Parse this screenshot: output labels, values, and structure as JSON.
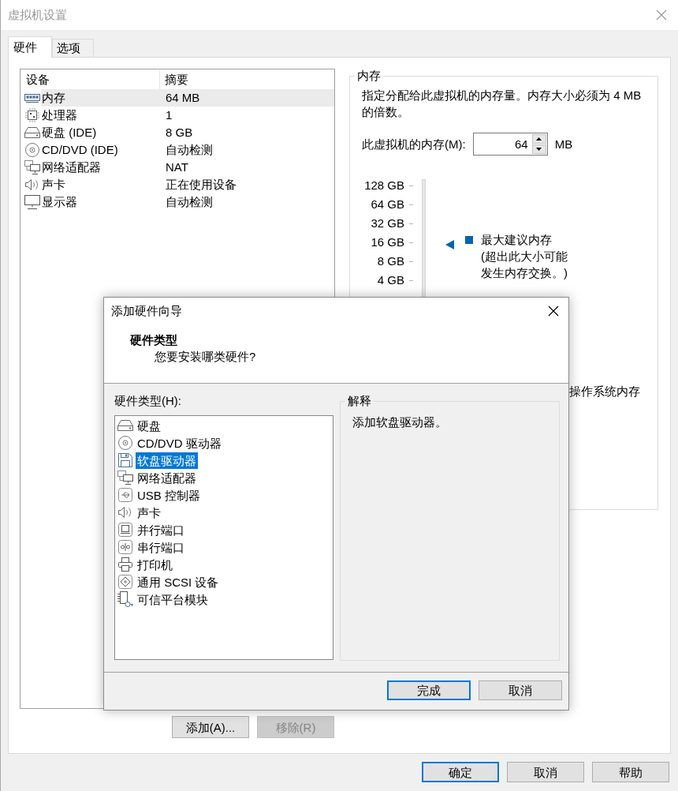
{
  "window": {
    "title": "虚拟机设置",
    "active": false
  },
  "tabs": [
    {
      "label": "硬件",
      "selected": true
    },
    {
      "label": "选项",
      "selected": false
    }
  ],
  "device_table": {
    "columns": [
      "设备",
      "摘要"
    ],
    "rows": [
      {
        "kind": "memory",
        "device": "内存",
        "summary": "64 MB",
        "selected": true
      },
      {
        "kind": "processor",
        "device": "处理器",
        "summary": "1",
        "selected": false
      },
      {
        "kind": "hard-disk",
        "device": "硬盘 (IDE)",
        "summary": "8 GB",
        "selected": false
      },
      {
        "kind": "cd-dvd",
        "device": "CD/DVD (IDE)",
        "summary": "自动检测",
        "selected": false
      },
      {
        "kind": "network",
        "device": "网络适配器",
        "summary": "NAT",
        "selected": false
      },
      {
        "kind": "sound",
        "device": "声卡",
        "summary": "正在使用设备",
        "selected": false
      },
      {
        "kind": "display",
        "device": "显示器",
        "summary": "自动检测",
        "selected": false
      }
    ]
  },
  "device_buttons": [
    {
      "label": "添加(A)...",
      "disabled": false
    },
    {
      "label": "移除(R)",
      "disabled": true
    }
  ],
  "memory_panel": {
    "title": "内存",
    "description": "指定分配给此虚拟机的内存量。内存大小必须为 4 MB 的倍数。",
    "field_label": "此虚拟机的内存(M):",
    "value": "64",
    "unit": "MB",
    "scale_labels": [
      "128 GB",
      "64 GB",
      "32 GB",
      "16 GB",
      "8 GB",
      "4 GB"
    ],
    "legend": [
      {
        "label": "最大建议内存",
        "note": "(超出此大小可能发生内存交换。)",
        "color": "#0063b1"
      }
    ],
    "partial_label": "操作系统内存"
  },
  "buttons": [
    {
      "label": "确定",
      "default": true
    },
    {
      "label": "取消",
      "default": false
    },
    {
      "label": "帮助",
      "default": false
    }
  ],
  "wizard": {
    "title": "添加硬件向导",
    "heading": "硬件类型",
    "subheading": "您要安装哪类硬件?",
    "list_label": "硬件类型(H):",
    "items": [
      {
        "kind": "hard-disk",
        "label": "硬盘",
        "selected": false
      },
      {
        "kind": "cd-dvd",
        "label": "CD/DVD 驱动器",
        "selected": false
      },
      {
        "kind": "floppy",
        "label": "软盘驱动器",
        "selected": true
      },
      {
        "kind": "network",
        "label": "网络适配器",
        "selected": false
      },
      {
        "kind": "usb",
        "label": "USB 控制器",
        "selected": false
      },
      {
        "kind": "sound",
        "label": "声卡",
        "selected": false
      },
      {
        "kind": "parallel",
        "label": "并行端口",
        "selected": false
      },
      {
        "kind": "serial",
        "label": "串行端口",
        "selected": false
      },
      {
        "kind": "printer",
        "label": "打印机",
        "selected": false
      },
      {
        "kind": "scsi",
        "label": "通用 SCSI 设备",
        "selected": false
      },
      {
        "kind": "tpm",
        "label": "可信平台模块",
        "selected": false
      }
    ],
    "explanation_title": "解释",
    "explanation": "添加软盘驱动器。",
    "buttons": [
      {
        "label": "完成",
        "default": true
      },
      {
        "label": "取消",
        "default": false
      }
    ]
  }
}
